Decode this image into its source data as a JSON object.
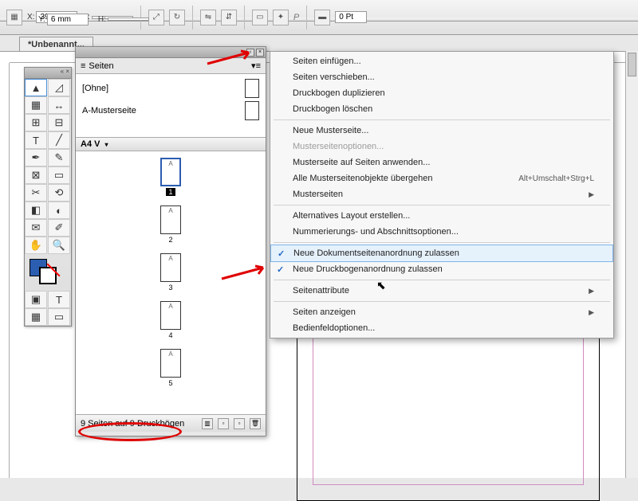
{
  "topbar": {
    "x_label": "X:",
    "x_value": "399 mm",
    "y_label": "Y:",
    "y_value": "6 mm",
    "w_label": "B:",
    "h_label": "H:",
    "stroke_value": "0 Pt"
  },
  "doc_tab": "*Unbenannt...",
  "pages_panel": {
    "title": "Seiten",
    "master_none": "[Ohne]",
    "master_a": "A-Musterseite",
    "layout_label": "A4 V",
    "pages": [
      "A",
      "A",
      "A",
      "A",
      "A"
    ],
    "page_nums": [
      "1",
      "2",
      "3",
      "4",
      "5"
    ],
    "footer_status": "9 Seiten auf 9 Druckbögen"
  },
  "menu": {
    "items": [
      {
        "t": "item",
        "label": "Seiten einfügen..."
      },
      {
        "t": "item",
        "label": "Seiten verschieben..."
      },
      {
        "t": "item",
        "label": "Druckbogen duplizieren"
      },
      {
        "t": "item",
        "label": "Druckbogen löschen"
      },
      {
        "t": "sep"
      },
      {
        "t": "item",
        "label": "Neue Musterseite..."
      },
      {
        "t": "item",
        "label": "Musterseitenoptionen...",
        "disabled": true
      },
      {
        "t": "item",
        "label": "Musterseite auf Seiten anwenden..."
      },
      {
        "t": "item",
        "label": "Alle Musterseitenobjekte übergehen",
        "shortcut": "Alt+Umschalt+Strg+L"
      },
      {
        "t": "item",
        "label": "Musterseiten",
        "sub": true
      },
      {
        "t": "sep"
      },
      {
        "t": "item",
        "label": "Alternatives Layout erstellen..."
      },
      {
        "t": "item",
        "label": "Nummerierungs- und Abschnittsoptionen..."
      },
      {
        "t": "sep"
      },
      {
        "t": "item",
        "label": "Neue Dokumentseitenanordnung zulassen",
        "checked": true,
        "hl": true
      },
      {
        "t": "item",
        "label": "Neue Druckbogenanordnung zulassen",
        "checked": true
      },
      {
        "t": "sep"
      },
      {
        "t": "item",
        "label": "Seitenattribute",
        "sub": true
      },
      {
        "t": "sep"
      },
      {
        "t": "item",
        "label": "Seiten anzeigen",
        "sub": true
      },
      {
        "t": "item",
        "label": "Bedienfeldoptionen..."
      }
    ]
  }
}
